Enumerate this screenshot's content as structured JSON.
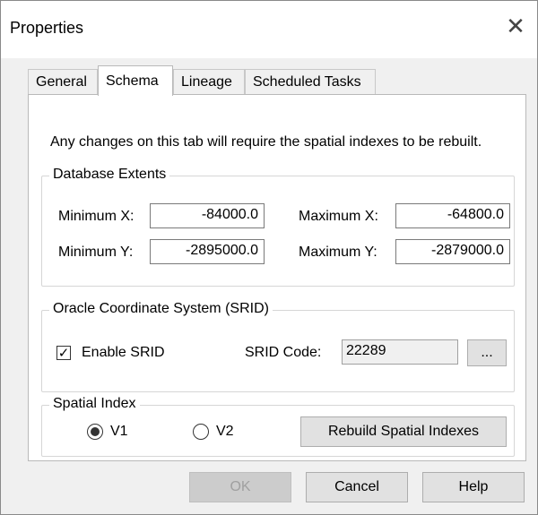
{
  "window": {
    "title": "Properties",
    "close_icon": "close-icon"
  },
  "tabs": [
    {
      "label": "General",
      "active": false
    },
    {
      "label": "Schema",
      "active": true
    },
    {
      "label": "Lineage",
      "active": false
    },
    {
      "label": "Scheduled Tasks",
      "active": false
    }
  ],
  "schema": {
    "info_text": "Any changes on this tab will require the spatial indexes to be rebuilt.",
    "extents": {
      "title": "Database Extents",
      "min_x_label": "Minimum X:",
      "min_x_value": "-84000.0",
      "max_x_label": "Maximum X:",
      "max_x_value": "-64800.0",
      "min_y_label": "Minimum Y:",
      "min_y_value": "-2895000.0",
      "max_y_label": "Maximum Y:",
      "max_y_value": "-2879000.0"
    },
    "srid": {
      "title": "Oracle Coordinate System (SRID)",
      "enable_label": "Enable SRID",
      "enable_checked": true,
      "code_label": "SRID Code:",
      "code_value": "22289",
      "browse_label": "..."
    },
    "spatial_index": {
      "title": "Spatial Index",
      "v1_label": "V1",
      "v2_label": "V2",
      "selected": "V1",
      "rebuild_label": "Rebuild Spatial Indexes"
    }
  },
  "footer": {
    "ok_label": "OK",
    "cancel_label": "Cancel",
    "help_label": "Help"
  },
  "colors": {
    "window_bg": "#f0f0f0",
    "panel_bg": "#ffffff",
    "border": "#b9b9b9"
  }
}
